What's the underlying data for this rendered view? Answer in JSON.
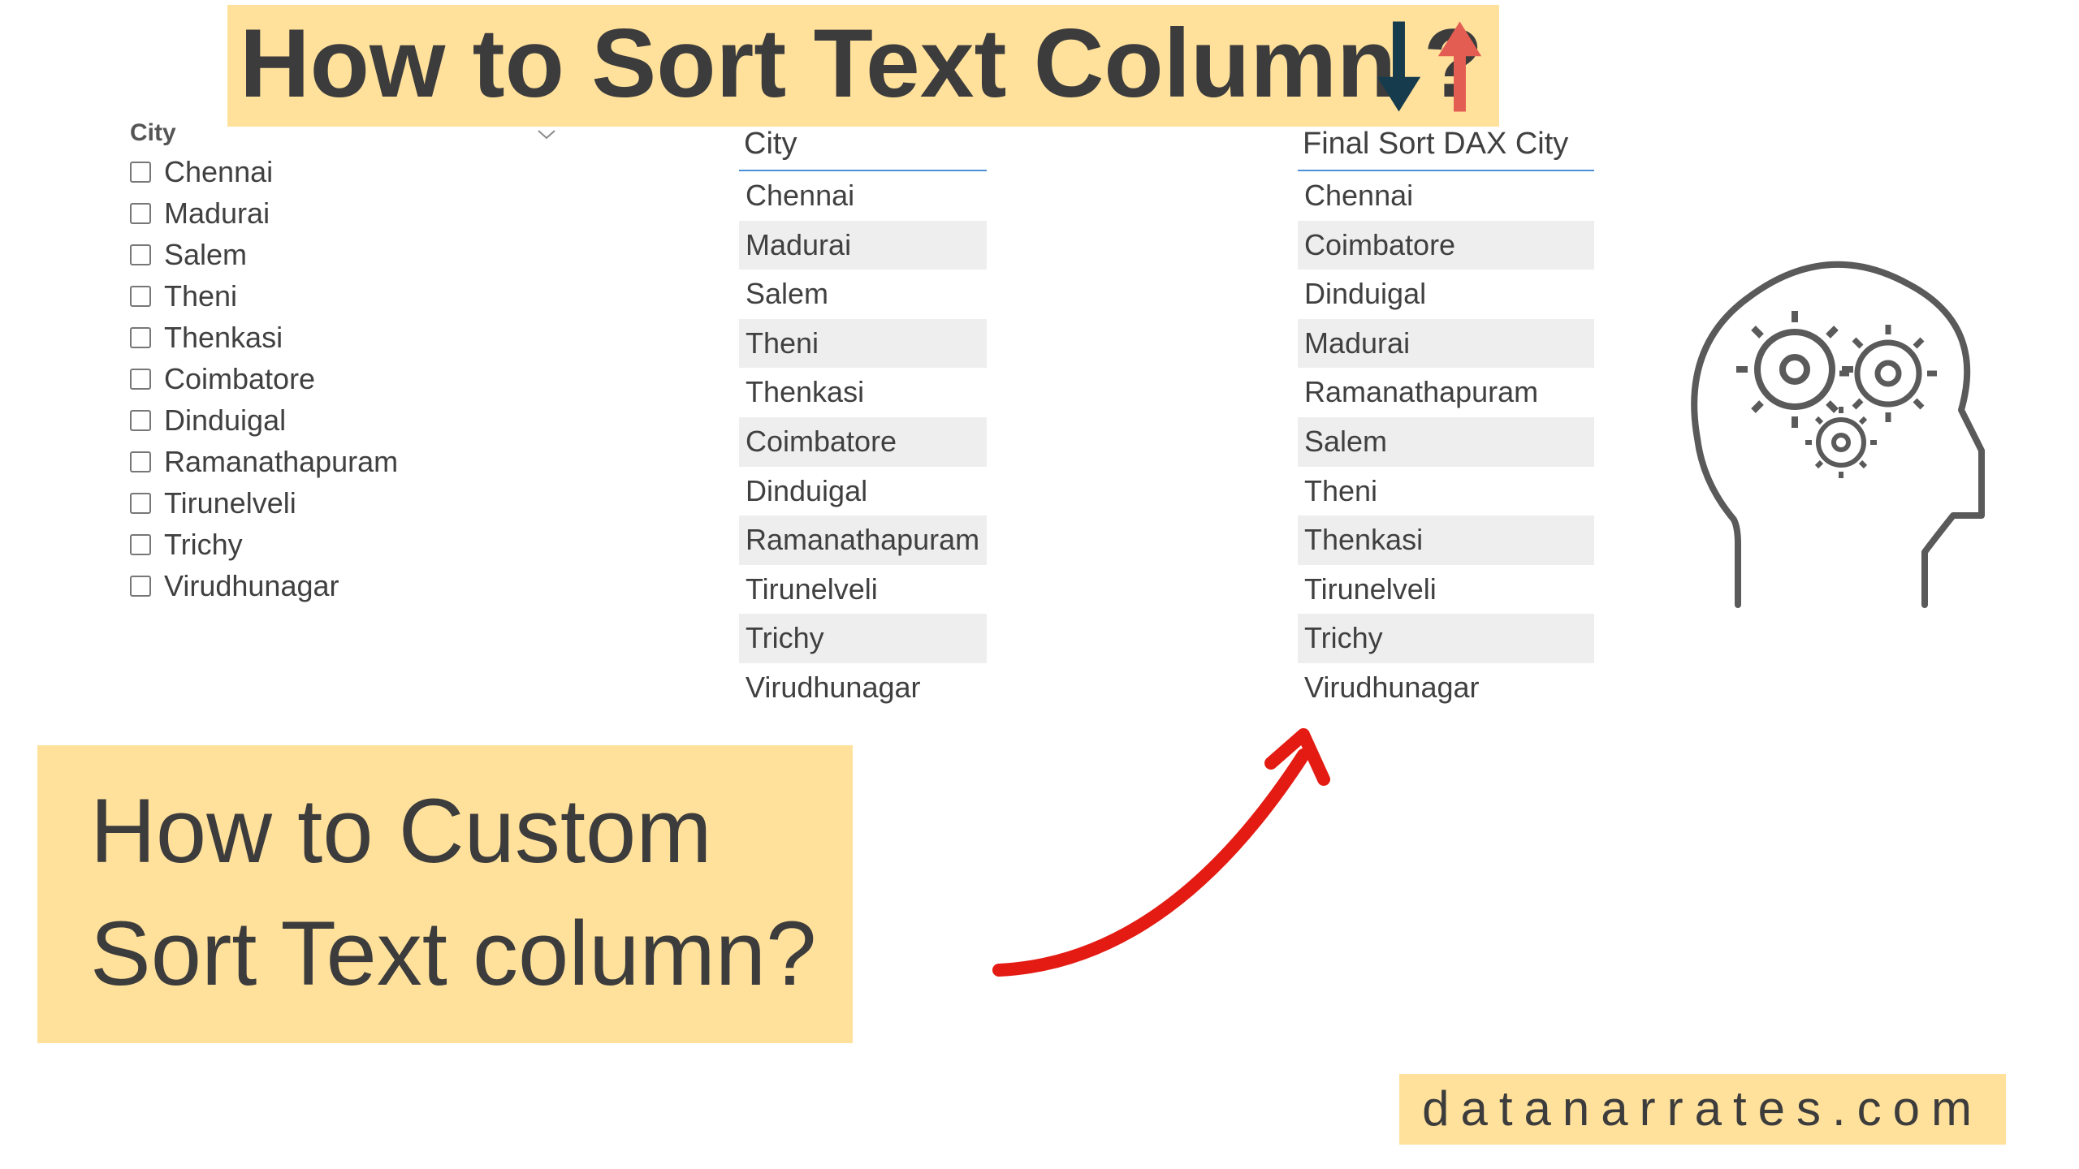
{
  "title": "How to Sort Text Column ?",
  "subtitle_line1": "How to Custom",
  "subtitle_line2": "Sort Text column?",
  "footer_url": "datanarrates.com",
  "slicer": {
    "title": "City",
    "items": [
      "Chennai",
      "Madurai",
      "Salem",
      "Theni",
      "Thenkasi",
      "Coimbatore",
      "Dinduigal",
      "Ramanathapuram",
      "Tirunelveli",
      "Trichy",
      "Virudhunagar"
    ]
  },
  "city_table": {
    "header": "City",
    "rows": [
      "Chennai",
      "Madurai",
      "Salem",
      "Theni",
      "Thenkasi",
      "Coimbatore",
      "Dinduigal",
      "Ramanathapuram",
      "Tirunelveli",
      "Trichy",
      "Virudhunagar"
    ]
  },
  "final_table": {
    "header": "Final Sort DAX City",
    "rows": [
      "Chennai",
      "Coimbatore",
      "Dinduigal",
      "Madurai",
      "Ramanathapuram",
      "Salem",
      "Theni",
      "Thenkasi",
      "Tirunelveli",
      "Trichy",
      "Virudhunagar"
    ]
  },
  "colors": {
    "banner_bg": "#ffe19b",
    "arrow_down": "#163b4d",
    "arrow_up": "#e45d52",
    "curved_arrow": "#e31b13",
    "stroke_gray": "#5a5a5a"
  }
}
